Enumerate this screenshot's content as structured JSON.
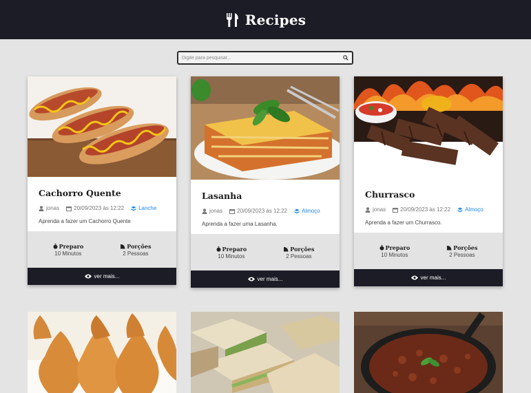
{
  "header": {
    "title": "Recipes",
    "icon": "utensils-icon"
  },
  "search": {
    "placeholder": "Digite para pesquisar...",
    "value": ""
  },
  "labels": {
    "preparo": "Preparo",
    "porcoes": "Porções",
    "ver_mais": "ver mais..."
  },
  "colors": {
    "header_bg": "#1b1c26",
    "page_bg": "#e4e4e4",
    "category": "#1e88e5"
  },
  "recipes": [
    {
      "title": "Cachorro Quente",
      "author": "jonas",
      "date": "20/09/2023 às 12:22",
      "category": "Lanche",
      "description": "Aprenda a fazer um Cachorro Quente",
      "prep": "10 Minutos",
      "servings": "2 Pessoas"
    },
    {
      "title": "Lasanha",
      "author": "jonas",
      "date": "20/09/2023 às 12:22",
      "category": "Almoço",
      "description": "Aprenda a fazer uma Lasanha.",
      "prep": "10 Minutos",
      "servings": "2 Pessoas"
    },
    {
      "title": "Churrasco",
      "author": "jonas",
      "date": "20/09/2023 às 12:22",
      "category": "Almoço",
      "description": "Aprenda a fazer um Churrasco.",
      "prep": "10 Minutos",
      "servings": "2 Pessoas"
    }
  ]
}
